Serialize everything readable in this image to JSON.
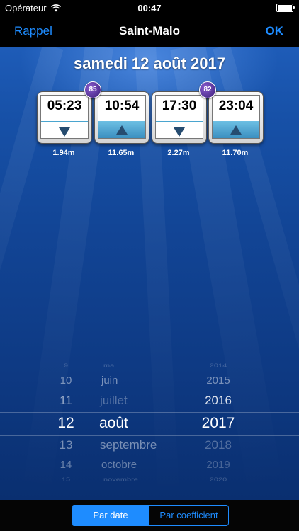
{
  "status": {
    "carrier": "Opérateur",
    "time": "00:47"
  },
  "nav": {
    "left": "Rappel",
    "title": "Saint-Malo",
    "right": "OK"
  },
  "date_title": "samedi 12 août 2017",
  "tides": [
    {
      "time": "05:23",
      "type": "low",
      "height": "1.94m"
    },
    {
      "time": "10:54",
      "type": "high",
      "height": "11.65m"
    },
    {
      "time": "17:30",
      "type": "low",
      "height": "2.27m"
    },
    {
      "time": "23:04",
      "type": "high",
      "height": "11.70m"
    }
  ],
  "coefficients": [
    "85",
    "82"
  ],
  "picker": {
    "days": [
      "9",
      "10",
      "11",
      "12",
      "13",
      "14",
      "15"
    ],
    "months": [
      "mai",
      "juin",
      "juillet",
      "août",
      "septembre",
      "octobre",
      "novembre"
    ],
    "years": [
      "2014",
      "2015",
      "2016",
      "2017",
      "2018",
      "2019",
      "2020"
    ]
  },
  "segmented": {
    "option1": "Par date",
    "option2": "Par coefficient"
  }
}
